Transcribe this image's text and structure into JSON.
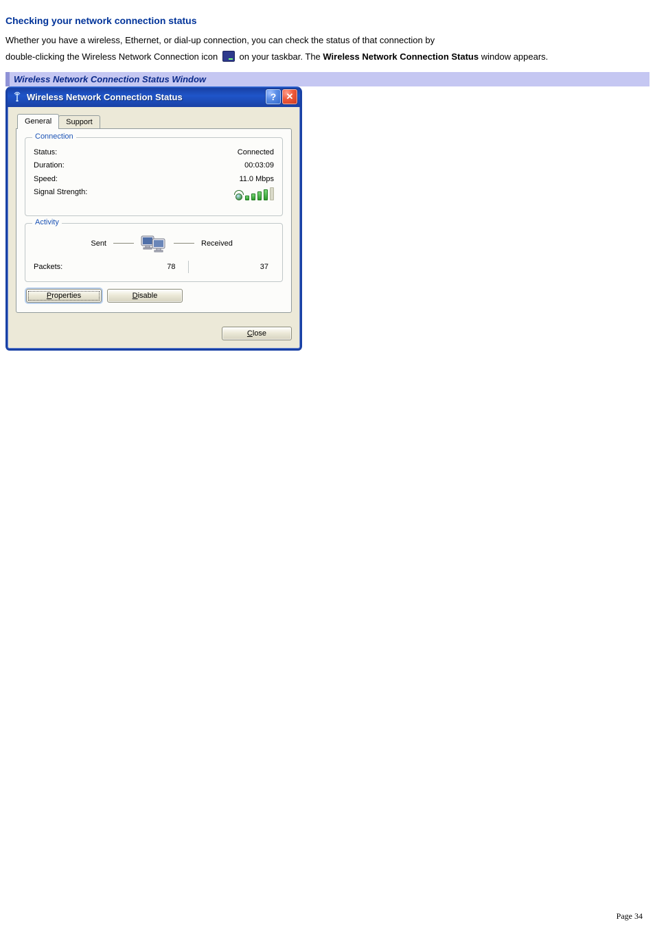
{
  "doc": {
    "heading": "Checking your network connection status",
    "intro_1": "Whether you have a wireless, Ethernet, or dial-up connection, you can check the status of that connection by",
    "intro_2a": "double-clicking the Wireless Network Connection icon ",
    "intro_2b": " on your taskbar. The ",
    "intro_bold": "Wireless Network Connection Status",
    "intro_2c": " window appears.",
    "caption": "Wireless Network Connection Status Window",
    "page_label": "Page 34"
  },
  "window": {
    "title": "Wireless Network Connection Status",
    "tabs": {
      "general": "General",
      "support": "Support"
    },
    "groups": {
      "connection": "Connection",
      "activity": "Activity"
    },
    "connection": {
      "status_label": "Status:",
      "status_value": "Connected",
      "duration_label": "Duration:",
      "duration_value": "00:03:09",
      "speed_label": "Speed:",
      "speed_value": "11.0 Mbps",
      "signal_label": "Signal Strength:"
    },
    "activity": {
      "sent_label": "Sent",
      "received_label": "Received",
      "packets_label": "Packets:",
      "packets_sent": "78",
      "packets_received": "37"
    },
    "buttons": {
      "properties_accel": "P",
      "properties_rest": "roperties",
      "disable_accel": "D",
      "disable_rest": "isable",
      "close_accel": "C",
      "close_rest": "lose"
    },
    "help_glyph": "?",
    "close_glyph": "✕"
  }
}
